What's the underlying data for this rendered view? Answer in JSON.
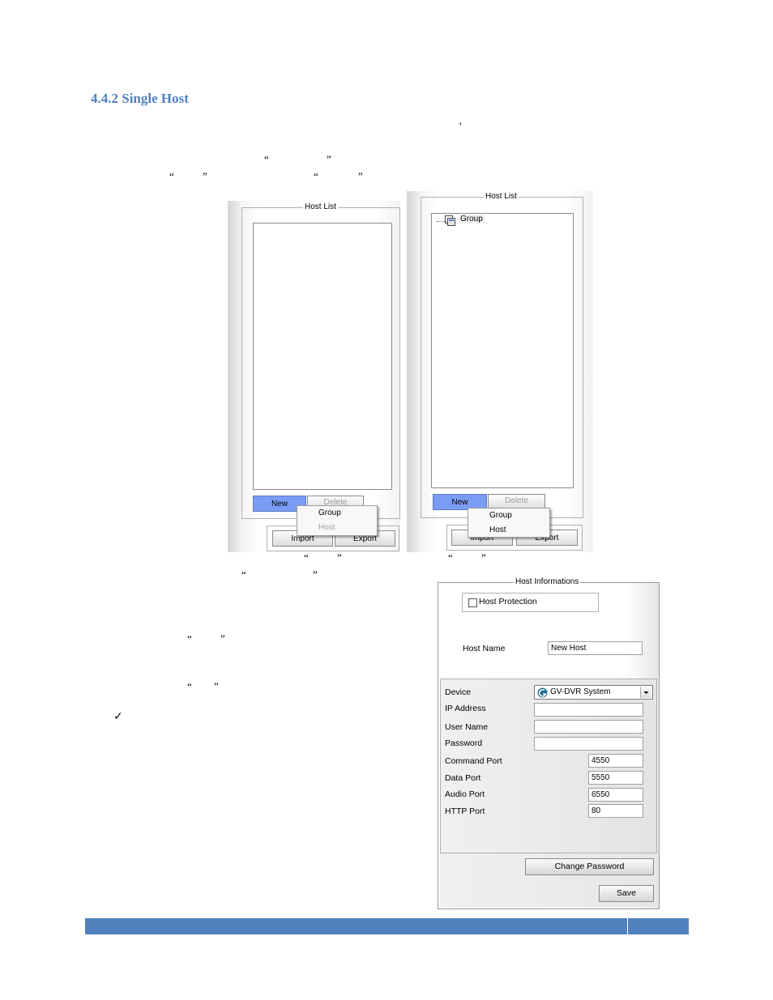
{
  "section": {
    "heading": "4.4.2 Single Host"
  },
  "marks": {
    "apostrophe": "’",
    "open_quote": "“",
    "close_quote": "”",
    "checkmark": "✓"
  },
  "host_list_left": {
    "legend": "Host List",
    "buttons": {
      "new": "New",
      "delete": "Delete",
      "import": "Import",
      "export": "Export"
    },
    "menu": [
      "Group",
      "Host"
    ]
  },
  "host_list_right": {
    "legend": "Host List",
    "tree": [
      "Group"
    ],
    "buttons": {
      "new": "New",
      "delete": "Delete",
      "import": "Import",
      "export": "Export"
    },
    "menu": [
      "Group",
      "Host"
    ]
  },
  "host_info": {
    "legend": "Host Informations",
    "protection_label": "Host Protection",
    "host_name_label": "Host Name",
    "host_name_value": "New Host",
    "device_label": "Device",
    "device_value": "GV-DVR System",
    "ip_label": "IP Address",
    "ip_value": "",
    "user_label": "User Name",
    "user_value": "",
    "password_label": "Password",
    "password_value": "",
    "command_port_label": "Command Port",
    "command_port_value": "4550",
    "data_port_label": "Data Port",
    "data_port_value": "5550",
    "audio_port_label": "Audio Port",
    "audio_port_value": "6550",
    "http_port_label": "HTTP Port",
    "http_port_value": "80",
    "change_password_button": "Change Password",
    "save_button": "Save"
  }
}
